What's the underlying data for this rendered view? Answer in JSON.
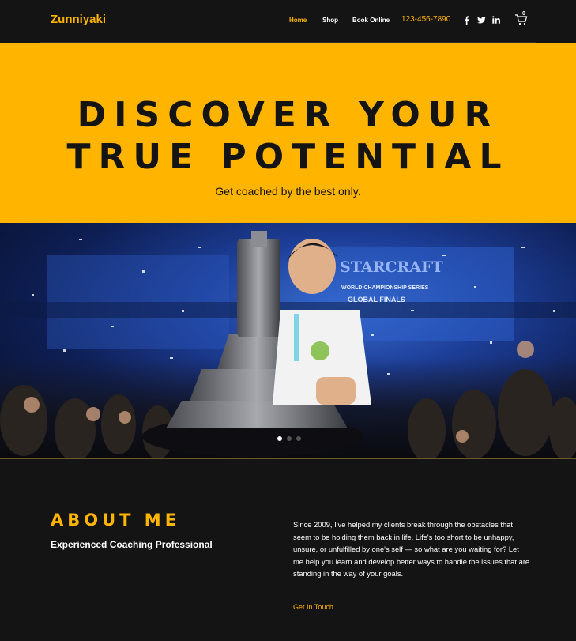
{
  "header": {
    "brand": "Zunniyaki",
    "nav": [
      {
        "label": "Home",
        "active": true
      },
      {
        "label": "Shop",
        "active": false
      },
      {
        "label": "Book Online",
        "active": false
      }
    ],
    "phone": "123-456-7890",
    "social": [
      "facebook-icon",
      "twitter-icon",
      "linkedin-icon"
    ],
    "cart_count": "0"
  },
  "hero": {
    "title_line1": "DISCOVER YOUR",
    "title_line2": "TRUE POTENTIAL",
    "subtitle": "Get coached by the best only."
  },
  "slideshow": {
    "slide_count": 3,
    "active_slide": 1,
    "photo_text_line1": "STARCRAFT",
    "photo_text_line2": "WORLD CHAMPIONSHIP SERIES",
    "photo_text_line3": "GLOBAL FINALS"
  },
  "about": {
    "title": "ABOUT ME",
    "subtitle": "Experienced Coaching Professional",
    "body": "Since 2009, I've helped my clients break through the obstacles that seem to be holding them back in life. Life's too short to be unhappy, unsure, or unfulfilled by one's self — so what are you waiting for? Let me help you learn and develop better ways to handle the issues that are standing in the way of your goals.",
    "cta": "Get In Touch"
  },
  "colors": {
    "accent": "#ffb400",
    "background": "#141414",
    "text_dark": "#141414"
  }
}
